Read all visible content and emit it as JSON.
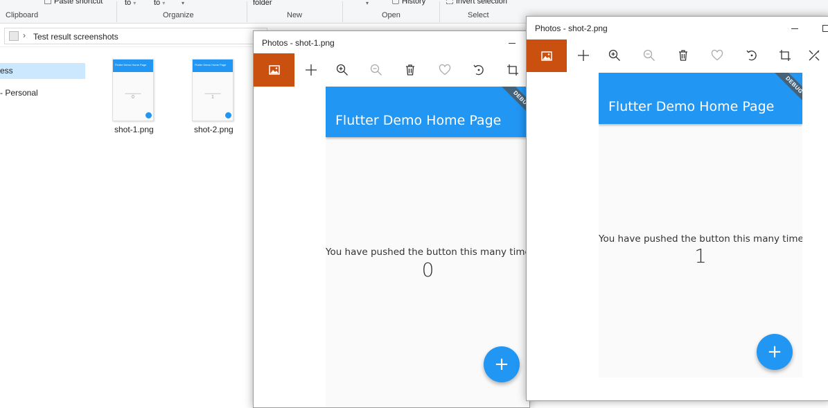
{
  "explorer": {
    "ribbon": {
      "paste_shortcut": "Paste shortcut",
      "move_to": "to",
      "copy_to": "to",
      "new_folder": "folder",
      "history": "History",
      "invert_selection": "Invert selection",
      "groups": [
        "Clipboard",
        "Organize",
        "New",
        "Open",
        "Select"
      ]
    },
    "address": {
      "path": "Test result screenshots"
    },
    "nav": {
      "selected_item": "ess",
      "personal_item": "- Personal"
    },
    "files": [
      {
        "name": "shot-1.png",
        "title": "Flutter Demo Home Page",
        "count": "0"
      },
      {
        "name": "shot-2.png",
        "title": "Flutter Demo Home Page",
        "count": "1"
      }
    ]
  },
  "photos_windows": [
    {
      "title": "Photos - shot-1.png",
      "app": {
        "appbar_title": "Flutter Demo Home Page",
        "body_text": "You have pushed the button this many times:",
        "counter": "0",
        "fab_label": "+",
        "debug_banner": "DEBUG"
      }
    },
    {
      "title": "Photos - shot-2.png",
      "app": {
        "appbar_title": "Flutter Demo Home Page",
        "body_text": "You have pushed the button this many times:",
        "counter": "1",
        "fab_label": "+",
        "debug_banner": "DEBUG"
      }
    }
  ],
  "colors": {
    "flutter_blue": "#2196f3",
    "photos_accent": "#ca5010",
    "nav_selection": "#cce8ff"
  },
  "icons": [
    "image-icon",
    "move-icon",
    "zoom-in-icon",
    "zoom-out-icon",
    "delete-icon",
    "heart-icon",
    "rotate-icon",
    "crop-icon",
    "edit-icon",
    "minimize-icon",
    "maximize-icon",
    "close-icon",
    "folder-icon",
    "chevron-right-icon",
    "dropdown-icon"
  ]
}
